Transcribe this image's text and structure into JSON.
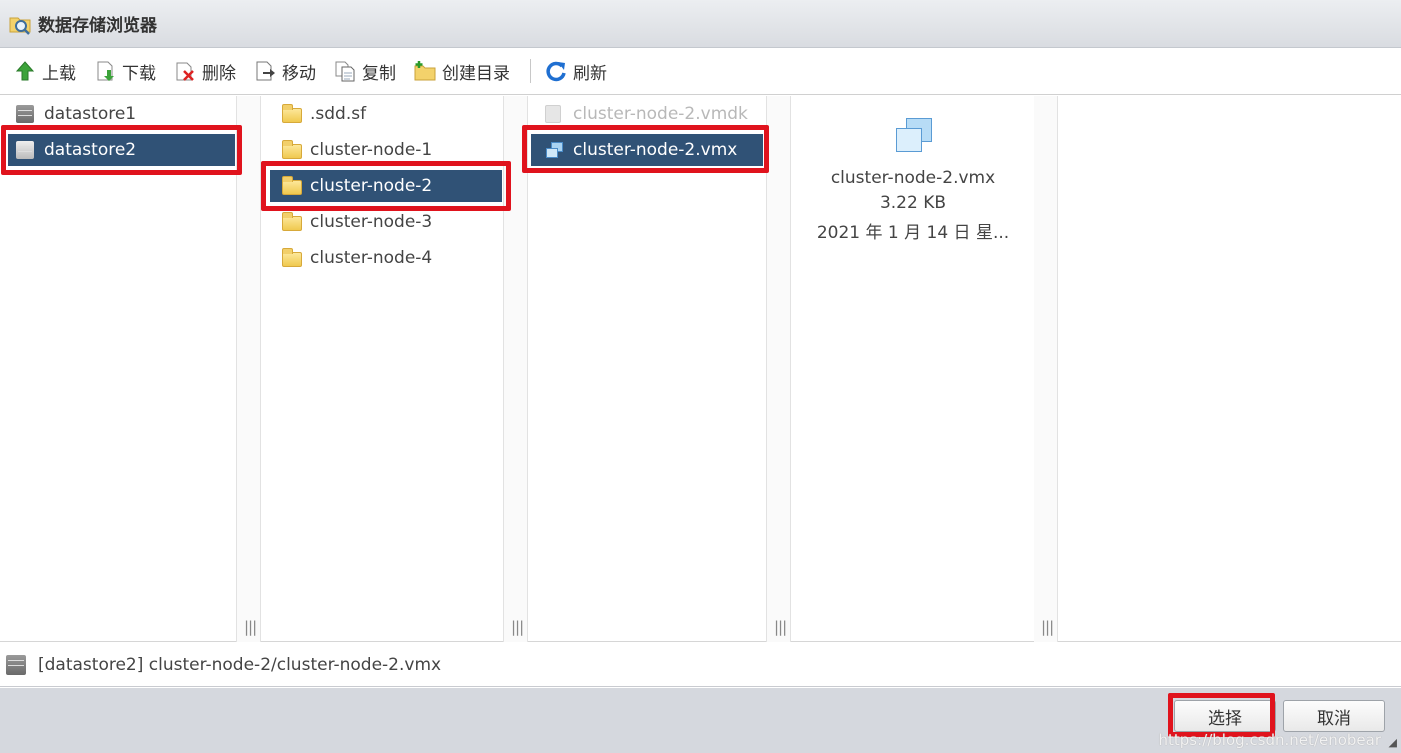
{
  "window": {
    "title": "数据存储浏览器",
    "title_icon": "datastore-browser-icon"
  },
  "toolbar": {
    "buttons": [
      {
        "label": "上载",
        "icon": "upload-arrow-icon"
      },
      {
        "label": "下载",
        "icon": "download-icon"
      },
      {
        "label": "删除",
        "icon": "delete-icon"
      },
      {
        "label": "移动",
        "icon": "move-icon"
      },
      {
        "label": "复制",
        "icon": "copy-icon"
      },
      {
        "label": "创建目录",
        "icon": "new-folder-icon"
      },
      {
        "label": "刷新",
        "icon": "refresh-icon"
      }
    ]
  },
  "columns": {
    "datastores": [
      {
        "label": "datastore1",
        "selected": false
      },
      {
        "label": "datastore2",
        "selected": true
      }
    ],
    "folders": [
      {
        "label": ".sdd.sf",
        "selected": false
      },
      {
        "label": "cluster-node-1",
        "selected": false
      },
      {
        "label": "cluster-node-2",
        "selected": true
      },
      {
        "label": "cluster-node-3",
        "selected": false
      },
      {
        "label": "cluster-node-4",
        "selected": false
      }
    ],
    "files": [
      {
        "label": "cluster-node-2.vmdk",
        "selected": false,
        "disabled": true
      },
      {
        "label": "cluster-node-2.vmx",
        "selected": true,
        "disabled": false
      }
    ],
    "splitter_grip": "|||"
  },
  "detail": {
    "name": "cluster-node-2.vmx",
    "size": "3.22 KB",
    "date": "2021 年 1 月 14 日 星..."
  },
  "pathbar": {
    "path": "[datastore2] cluster-node-2/cluster-node-2.vmx"
  },
  "footer": {
    "select_label": "选择",
    "cancel_label": "取消",
    "watermark": "https://blog.csdn.net/enobear"
  },
  "colors": {
    "selection": "#305276",
    "highlight": "#e0131d",
    "footer_bg": "#d5d8de"
  }
}
